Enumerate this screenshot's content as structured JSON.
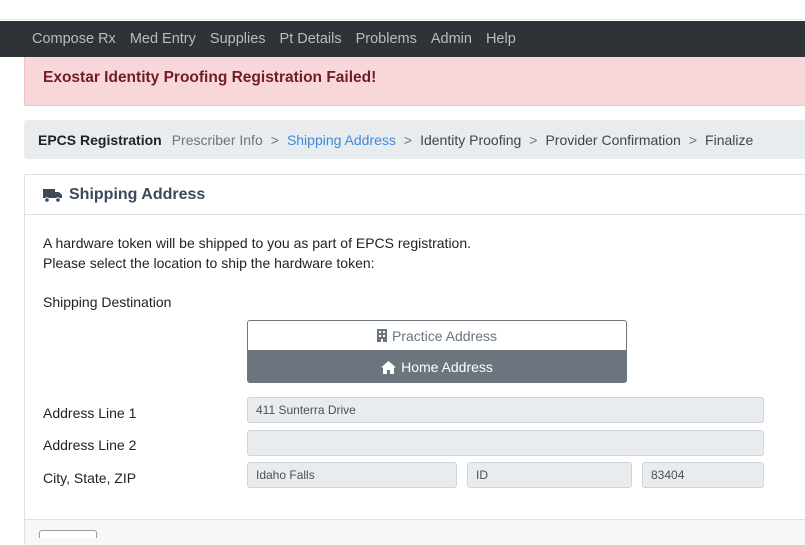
{
  "nav": {
    "items": [
      "Compose Rx",
      "Med Entry",
      "Supplies",
      "Pt Details",
      "Problems",
      "Admin",
      "Help"
    ]
  },
  "alert": {
    "text": "Exostar Identity Proofing Registration Failed!"
  },
  "breadcrumb": {
    "title": "EPCS Registration",
    "steps": [
      "Prescriber Info",
      "Shipping Address",
      "Identity Proofing",
      "Provider Confirmation",
      "Finalize"
    ],
    "separator": ">"
  },
  "card": {
    "icon": "truck-icon",
    "title": "Shipping Address",
    "intro_line1": "A hardware token will be shipped to you as part of EPCS registration.",
    "intro_line2": "Please select the location to ship the hardware token:",
    "destination_label": "Shipping Destination",
    "practice_button": "Practice Address",
    "home_button": "Home Address",
    "selected": "Home Address"
  },
  "form": {
    "address1_label": "Address Line 1",
    "address1_value": "411 Sunterra Drive",
    "address2_label": "Address Line 2",
    "address2_value": "",
    "csz_label": "City, State, ZIP",
    "city_value": "Idaho Falls",
    "state_value": "ID",
    "zip_value": "83404"
  },
  "colors": {
    "navbar": "#2f3338",
    "alert_bg": "#f8d7da",
    "alert_text": "#721c24",
    "active_step": "#3d8bd8",
    "selected_button": "#6c757d"
  }
}
